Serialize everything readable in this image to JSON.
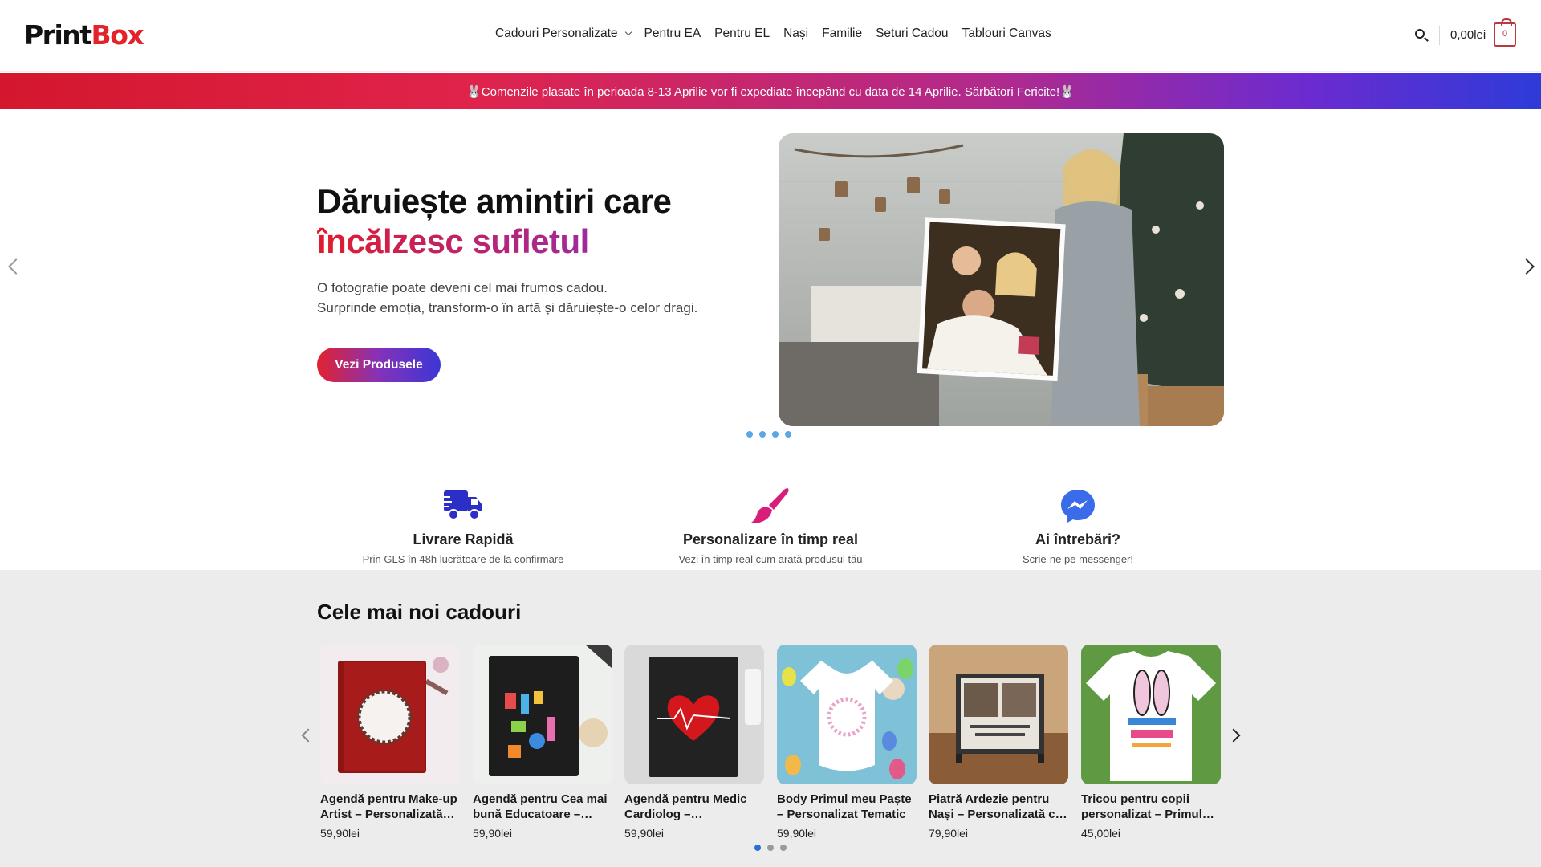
{
  "header": {
    "logo_part1": "Print",
    "logo_part2": "Box",
    "nav": [
      {
        "label": "Cadouri Personalizate",
        "has_dropdown": true
      },
      {
        "label": "Pentru EA"
      },
      {
        "label": "Pentru EL"
      },
      {
        "label": "Nași"
      },
      {
        "label": "Familie"
      },
      {
        "label": "Seturi Cadou"
      },
      {
        "label": "Tablouri Canvas"
      }
    ],
    "search_icon": "search-icon",
    "cart_total": "0,00lei",
    "cart_count": "0",
    "cart_icon": "shopping-bag-icon"
  },
  "announcement": {
    "text": "🐰Comenzile plasate în perioada 8-13 Aprilie vor fi expediate începând cu data de 14 Aprilie. Sărbători Fericite!🐰"
  },
  "hero": {
    "title_line1": "Dăruiește amintiri care",
    "title_line2": "încălzesc sufletul",
    "desc_line1": "O fotografie poate deveni cel mai frumos cadou.",
    "desc_line2": "Surprinde emoția, transform-o în artă și dăruiește-o celor dragi.",
    "cta": "Vezi Produsele",
    "slides_count": 4
  },
  "features": [
    {
      "title": "Livrare Rapidă",
      "subtitle": "Prin GLS în 48h lucrătoare de la confirmare",
      "icon": "truck-icon"
    },
    {
      "title": "Personalizare în timp real",
      "subtitle": "Vezi în timp real cum arată produsul tău",
      "icon": "paintbrush-icon"
    },
    {
      "title": "Ai întrebări?",
      "subtitle": "Scrie-ne pe messenger!",
      "icon": "messenger-icon"
    }
  ],
  "products_section": {
    "title": "Cele mai noi cadouri",
    "items": [
      {
        "name": "Agendă pentru Make-up Artist – Personalizată cu Nume",
        "price": "59,90lei"
      },
      {
        "name": "Agendă pentru Cea mai bună Educatoare – Personalizată",
        "price": "59,90lei"
      },
      {
        "name": "Agendă pentru Medic Cardiolog – Personalizată",
        "price": "59,90lei"
      },
      {
        "name": "Body Primul meu Paște – Personalizat Tematic",
        "price": "59,90lei"
      },
      {
        "name": "Piatră Ardezie pentru Nași – Personalizată cu Poze",
        "price": "79,90lei"
      },
      {
        "name": "Tricou pentru copii personalizat – Primul meu Paște",
        "price": "45,00lei"
      }
    ],
    "pagination_pages": 3,
    "active_page": 1
  },
  "colors": {
    "brand_red": "#e2232a",
    "accent_purple": "#8532b8",
    "accent_blue": "#3c36d6",
    "dot_blue": "#5aa7e6"
  }
}
